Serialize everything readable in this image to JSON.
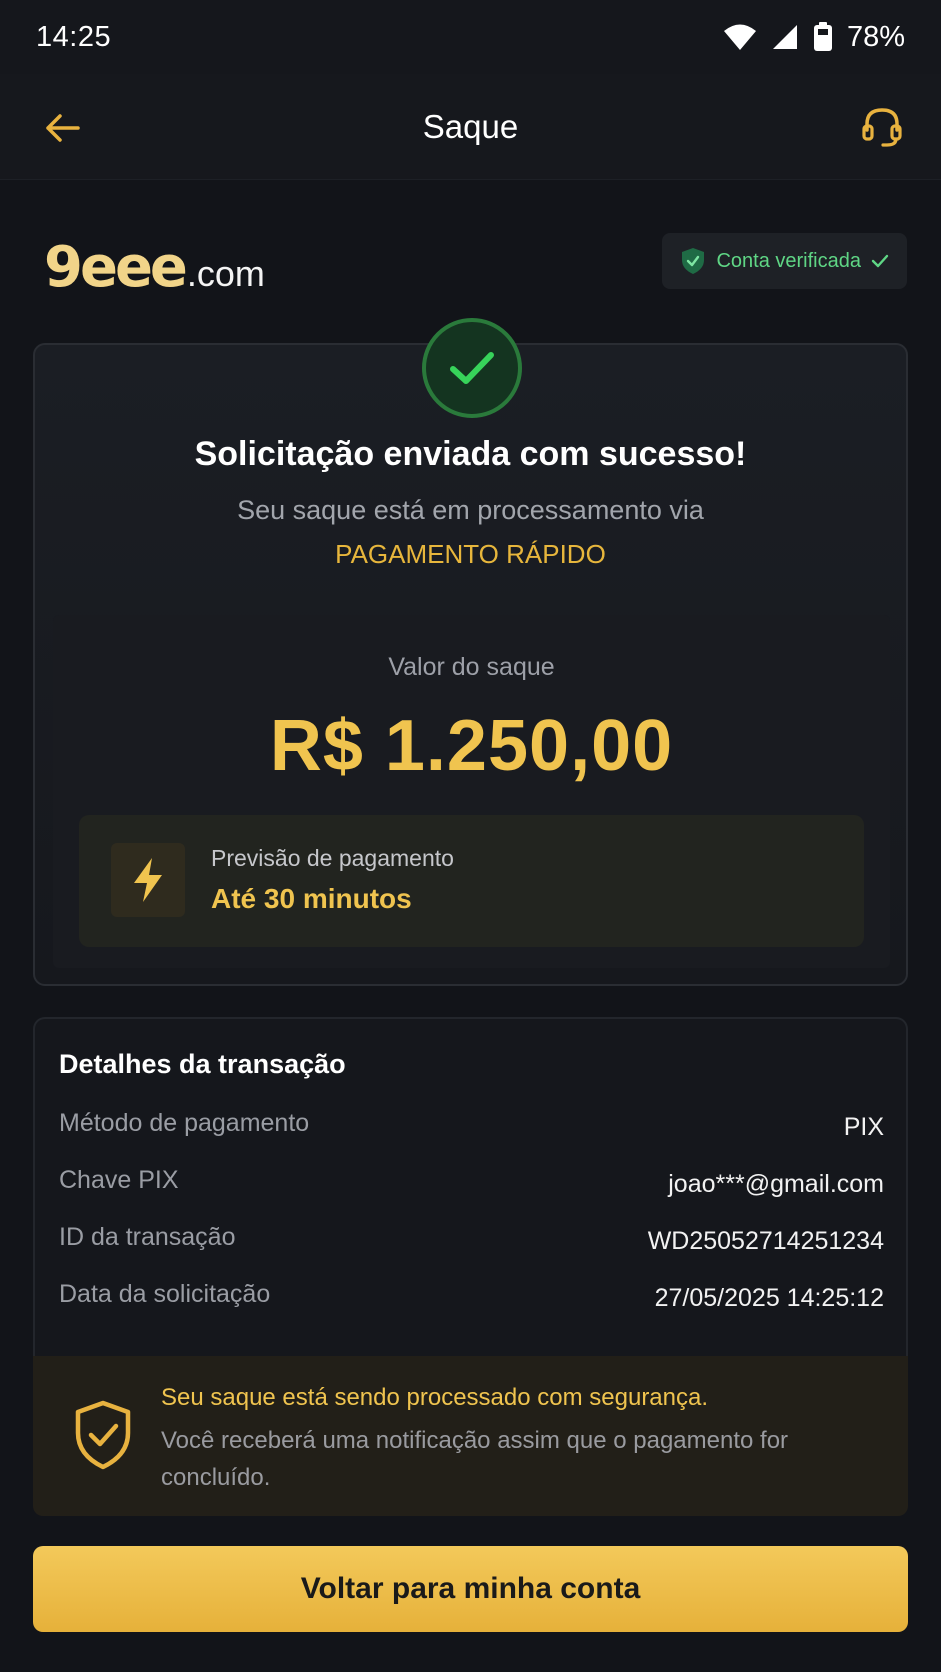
{
  "status_bar": {
    "time": "14:25",
    "battery_percent": "78%"
  },
  "nav": {
    "title": "Saque"
  },
  "brand": {
    "logo_main": "9eee",
    "logo_domain": ".com",
    "verified_label": "Conta verificada"
  },
  "success": {
    "title": "Solicitação enviada com sucesso!",
    "subtitle": "Seu saque está em processamento via",
    "method": "PAGAMENTO RÁPIDO",
    "amount_label": "Valor do saque",
    "amount": "R$ 1.250,00",
    "eta_label": "Previsão de pagamento",
    "eta_value": "Até 30 minutos"
  },
  "details": {
    "title": "Detalhes da transação",
    "rows": [
      {
        "label": "Método de pagamento",
        "value": "PIX"
      },
      {
        "label": "Chave PIX",
        "value": "joao***@gmail.com"
      },
      {
        "label": "ID da transação",
        "value": "WD25052714251234"
      },
      {
        "label": "Data da solicitação",
        "value": "27/05/2025 14:25:12"
      }
    ]
  },
  "security": {
    "title": "Seu saque está sendo processado com segurança.",
    "body": "Você receberá uma notificação assim que o pagamento for concluído."
  },
  "cta": {
    "label": "Voltar para minha conta"
  },
  "colors": {
    "background": "#121419",
    "accent_gold": "#f0c44f",
    "success_green": "#5fd685"
  }
}
